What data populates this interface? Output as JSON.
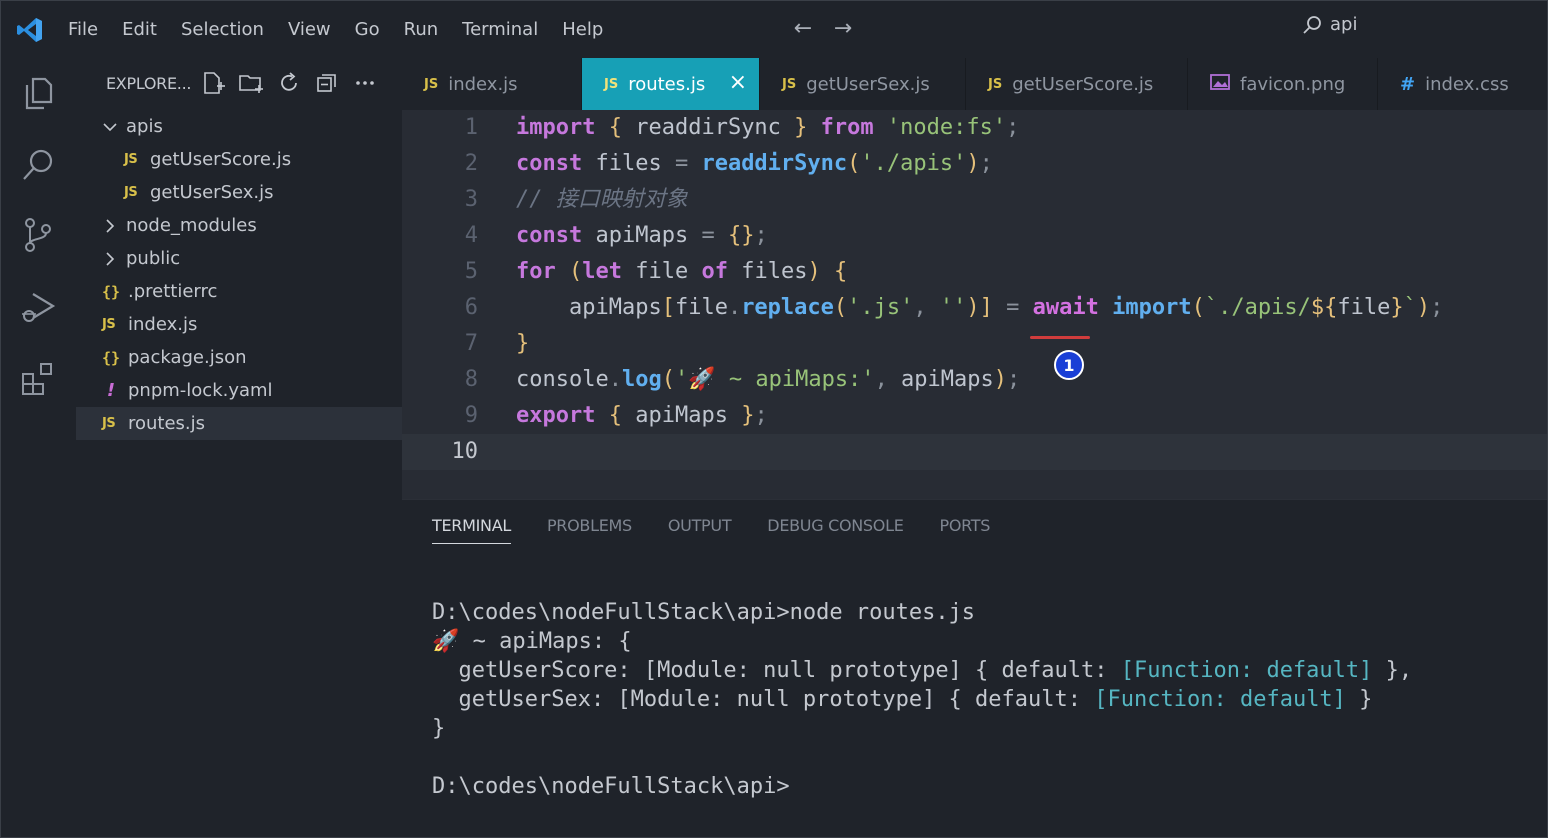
{
  "menu": [
    "File",
    "Edit",
    "Selection",
    "View",
    "Go",
    "Run",
    "Terminal",
    "Help"
  ],
  "command_center": {
    "label": "api",
    "icon": "search-icon"
  },
  "nav": {
    "back_icon": "arrow-left-icon",
    "forward_icon": "arrow-right-icon"
  },
  "activity_bar": [
    "explorer-icon",
    "search-icon",
    "source-control-icon",
    "run-debug-icon",
    "extensions-icon"
  ],
  "explorer": {
    "title": "EXPLORE...",
    "actions": [
      "new-file-icon",
      "new-folder-icon",
      "refresh-icon",
      "collapse-all-icon",
      "more-icon"
    ],
    "items": [
      {
        "label": "apis",
        "type": "folder-open",
        "depth": 0
      },
      {
        "label": "getUserScore.js",
        "type": "js",
        "depth": 1
      },
      {
        "label": "getUserSex.js",
        "type": "js",
        "depth": 1
      },
      {
        "label": "node_modules",
        "type": "folder",
        "depth": 0
      },
      {
        "label": "public",
        "type": "folder",
        "depth": 0
      },
      {
        "label": ".prettierrc",
        "type": "json",
        "depth": 0
      },
      {
        "label": "index.js",
        "type": "js",
        "depth": 0
      },
      {
        "label": "package.json",
        "type": "json",
        "depth": 0
      },
      {
        "label": "pnpm-lock.yaml",
        "type": "yaml",
        "depth": 0
      },
      {
        "label": "routes.js",
        "type": "js",
        "depth": 0,
        "selected": true
      }
    ],
    "js_glyph": "JS",
    "json_glyph": "{}",
    "yaml_glyph": "!"
  },
  "tabs": [
    {
      "label": "index.js",
      "glyph": "JS"
    },
    {
      "label": "routes.js",
      "glyph": "JS",
      "active": true,
      "close": "×"
    },
    {
      "label": "getUserSex.js",
      "glyph": "JS"
    },
    {
      "label": "getUserScore.js",
      "glyph": "JS"
    },
    {
      "label": "favicon.png",
      "glyph": "image-icon"
    },
    {
      "label": "index.css",
      "glyph": "#"
    }
  ],
  "editor": {
    "line_numbers": [
      "1",
      "2",
      "3",
      "4",
      "5",
      "6",
      "7",
      "8",
      "9",
      "10"
    ],
    "current_line": "10",
    "problem_badge": "1",
    "lines": [
      [
        [
          "kw",
          "import"
        ],
        [
          "plain",
          " "
        ],
        [
          "brace",
          "{"
        ],
        [
          "plain",
          " readdirSync "
        ],
        [
          "brace",
          "}"
        ],
        [
          "plain",
          " "
        ],
        [
          "kw",
          "from"
        ],
        [
          "plain",
          " "
        ],
        [
          "str",
          "'node:fs'"
        ],
        [
          "punc",
          ";"
        ]
      ],
      [
        [
          "kw",
          "const"
        ],
        [
          "plain",
          " files "
        ],
        [
          "punc",
          "="
        ],
        [
          "plain",
          " "
        ],
        [
          "fn",
          "readdirSync"
        ],
        [
          "brace",
          "("
        ],
        [
          "str",
          "'./apis'"
        ],
        [
          "brace",
          ")"
        ],
        [
          "punc",
          ";"
        ]
      ],
      [
        [
          "cmt",
          "// 接口映射对象"
        ]
      ],
      [
        [
          "kw",
          "const"
        ],
        [
          "plain",
          " apiMaps "
        ],
        [
          "punc",
          "="
        ],
        [
          "plain",
          " "
        ],
        [
          "brace",
          "{}"
        ],
        [
          "punc",
          ";"
        ]
      ],
      [
        [
          "kw",
          "for"
        ],
        [
          "plain",
          " "
        ],
        [
          "brace",
          "("
        ],
        [
          "kw",
          "let"
        ],
        [
          "plain",
          " file "
        ],
        [
          "kw",
          "of"
        ],
        [
          "plain",
          " files"
        ],
        [
          "brace",
          ")"
        ],
        [
          "plain",
          " "
        ],
        [
          "brace",
          "{"
        ]
      ],
      [
        [
          "plain",
          "    apiMaps"
        ],
        [
          "brace",
          "["
        ],
        [
          "plain",
          "file"
        ],
        [
          "punc",
          "."
        ],
        [
          "fn",
          "replace"
        ],
        [
          "brace",
          "("
        ],
        [
          "str",
          "'.js'"
        ],
        [
          "punc",
          ","
        ],
        [
          "plain",
          " "
        ],
        [
          "str",
          "''"
        ],
        [
          "brace",
          ")]"
        ],
        [
          "plain",
          " "
        ],
        [
          "punc",
          "="
        ],
        [
          "plain",
          " "
        ],
        [
          "aw",
          "await"
        ],
        [
          "plain",
          " "
        ],
        [
          "fn",
          "import"
        ],
        [
          "brace",
          "("
        ],
        [
          "str",
          "`./apis/"
        ],
        [
          "brace",
          "${"
        ],
        [
          "plain",
          "file"
        ],
        [
          "brace",
          "}"
        ],
        [
          "str",
          "`"
        ],
        [
          "brace",
          ")"
        ],
        [
          "punc",
          ";"
        ]
      ],
      [
        [
          "brace",
          "}"
        ]
      ],
      [
        [
          "plain",
          "console"
        ],
        [
          "punc",
          "."
        ],
        [
          "fn",
          "log"
        ],
        [
          "brace",
          "("
        ],
        [
          "str",
          "'🚀 ~ apiMaps:'"
        ],
        [
          "punc",
          ","
        ],
        [
          "plain",
          " apiMaps"
        ],
        [
          "brace",
          ")"
        ],
        [
          "punc",
          ";"
        ]
      ],
      [
        [
          "kw",
          "export"
        ],
        [
          "plain",
          " "
        ],
        [
          "brace",
          "{"
        ],
        [
          "plain",
          " apiMaps "
        ],
        [
          "brace",
          "}"
        ],
        [
          "punc",
          ";"
        ]
      ],
      []
    ]
  },
  "panel": {
    "tabs": [
      "TERMINAL",
      "PROBLEMS",
      "OUTPUT",
      "DEBUG CONSOLE",
      "PORTS"
    ],
    "active_tab": "TERMINAL",
    "terminal_lines": [
      [
        [
          "plain",
          "D:\\codes\\nodeFullStack\\api>node routes.js"
        ]
      ],
      [
        [
          "plain",
          "🚀 ~ apiMaps: {"
        ]
      ],
      [
        [
          "plain",
          "  getUserScore: [Module: null prototype] { default: "
        ],
        [
          "tcyan",
          "[Function: default]"
        ],
        [
          "plain",
          " },"
        ]
      ],
      [
        [
          "plain",
          "  getUserSex: [Module: null prototype] { default: "
        ],
        [
          "tcyan",
          "[Function: default]"
        ],
        [
          "plain",
          " }"
        ]
      ],
      [
        [
          "plain",
          "}"
        ]
      ],
      [
        [
          "plain",
          ""
        ]
      ],
      [
        [
          "plain",
          "D:\\codes\\nodeFullStack\\api>"
        ]
      ]
    ]
  },
  "colors": {
    "background": "#1f232a",
    "editor_bg": "#282c34",
    "active_tab": "#17a0b6",
    "keyword": "#c678dd",
    "function": "#61afef",
    "string": "#98c379",
    "js_icon": "#d8c04a",
    "error_squiggle": "#d03c3c",
    "badge": "#1a3fd6"
  }
}
